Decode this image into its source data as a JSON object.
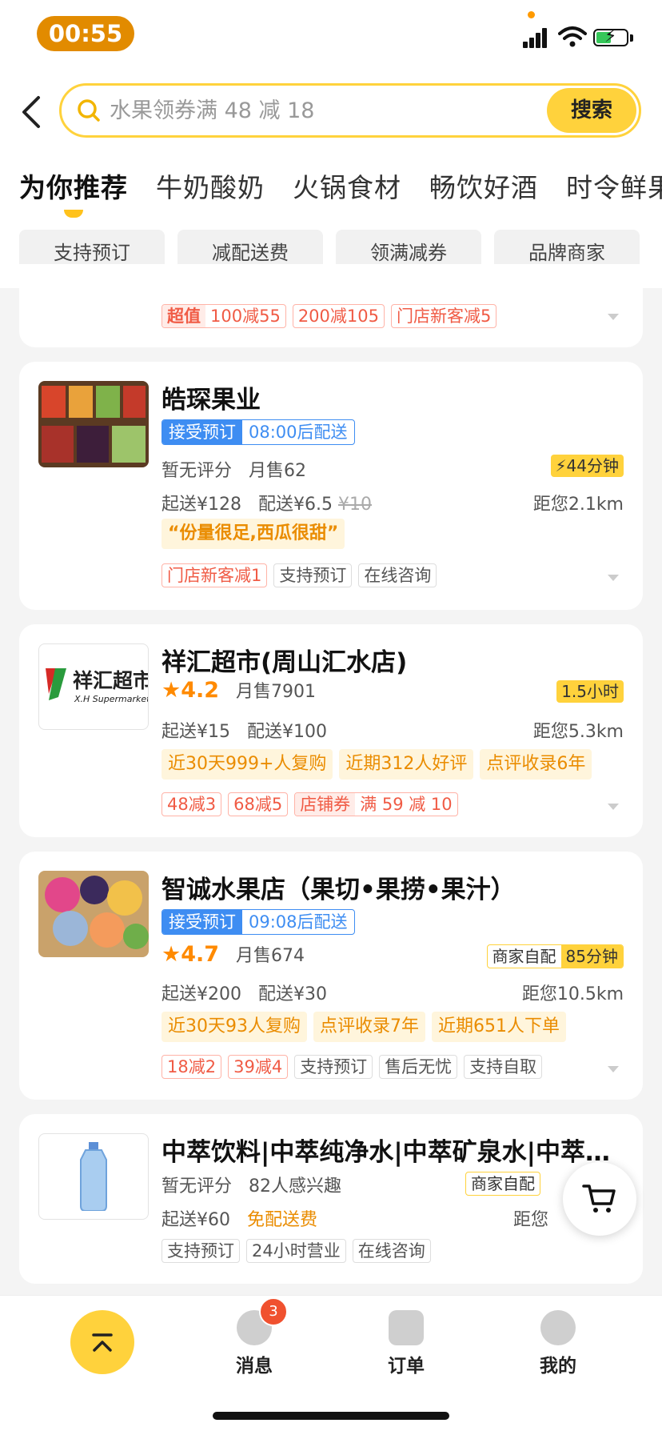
{
  "status_bar": {
    "time": "00:55"
  },
  "search": {
    "back_icon": "chevron-left-icon",
    "placeholder": "水果领券满 48 减 18",
    "button_label": "搜索"
  },
  "tabs": [
    "为你推荐",
    "牛奶酸奶",
    "火锅食材",
    "畅饮好酒",
    "时令鲜果"
  ],
  "filters": [
    "支持预订",
    "减配送费",
    "领满减券",
    "品牌商家"
  ],
  "prev_card": {
    "tags": [
      {
        "label": "超值",
        "extra": "100减55"
      },
      {
        "label": "200减105"
      },
      {
        "label": "门店新客减5"
      }
    ]
  },
  "stores": [
    {
      "name": "皓琛果业",
      "preorder": {
        "label": "接受预订",
        "time": "08:00后配送"
      },
      "rating": "暂无评分",
      "sales": "月售62",
      "delivery_time": "44分钟",
      "min_order": "起送¥128",
      "delivery_fee": "配送¥6.5",
      "original_fee": "¥10",
      "distance": "距您2.1km",
      "review": "“份量很足,西瓜很甜”",
      "tags": [
        "门店新客减1",
        "支持预订",
        "在线咨询"
      ]
    },
    {
      "name": "祥汇超市(周山汇水店)",
      "logo_text": "祥汇超市",
      "logo_subtext": "X.H Supermarket",
      "rating": "4.2",
      "sales": "月售7901",
      "delivery_time": "1.5小时",
      "min_order": "起送¥15",
      "delivery_fee": "配送¥100",
      "distance": "距您5.3km",
      "highlights": [
        "近30天999+人复购",
        "近期312人好评",
        "点评收录6年"
      ],
      "tags": [
        "48减3",
        "68减5"
      ],
      "coupon": {
        "label": "店铺券",
        "value": "满 59 减 10"
      }
    },
    {
      "name": "智诚水果店（果切•果捞•果汁）",
      "preorder": {
        "label": "接受预订",
        "time": "09:08后配送"
      },
      "rating": "4.7",
      "sales": "月售674",
      "self_delivery": "商家自配",
      "delivery_time": "85分钟",
      "min_order": "起送¥200",
      "delivery_fee": "配送¥30",
      "distance": "距您10.5km",
      "highlights": [
        "近30天93人复购",
        "点评收录7年",
        "近期651人下单"
      ],
      "tags": [
        "18减2",
        "39减4",
        "支持预订",
        "售后无忧",
        "支持自取"
      ]
    },
    {
      "name": "中萃饮料|中萃纯净水|中萃矿泉水|中萃…",
      "rating": "暂无评分",
      "sales": "82人感兴趣",
      "self_delivery": "商家自配",
      "min_order": "起送¥60",
      "delivery_fee": "免配送费",
      "distance": "距您",
      "tags": [
        "支持预订",
        "24小时营业",
        "在线咨询"
      ]
    }
  ],
  "tabbar": {
    "items": [
      {
        "label": "消息",
        "icon": "message-icon",
        "badge": "3"
      },
      {
        "label": "订单",
        "icon": "order-icon"
      },
      {
        "label": "我的",
        "icon": "profile-icon"
      }
    ]
  },
  "colors": {
    "accent": "#ffd23c",
    "time_pill": "#e28b00",
    "price_red": "#f05b45",
    "blue": "#3e8df2",
    "orange_text": "#ea8c00"
  }
}
